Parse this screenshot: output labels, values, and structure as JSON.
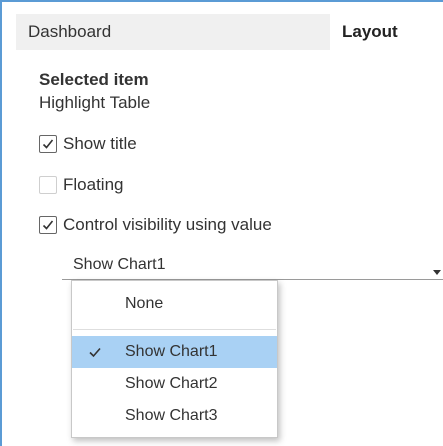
{
  "tabs": [
    {
      "label": "Dashboard"
    },
    {
      "label": "Layout"
    }
  ],
  "selected_item": {
    "heading": "Selected item",
    "value": "Highlight Table"
  },
  "options": [
    {
      "label": "Show title",
      "checked": true
    },
    {
      "label": "Floating",
      "checked": false
    },
    {
      "label": "Control visibility using value",
      "checked": true
    }
  ],
  "visibility_select": {
    "value": "Show Chart1",
    "arrow_icon": "caret-down-icon"
  },
  "dropdown": {
    "items": [
      {
        "label": "None",
        "selected": false
      },
      {
        "label": "Show Chart1",
        "selected": true
      },
      {
        "label": "Show Chart2",
        "selected": false
      },
      {
        "label": "Show Chart3",
        "selected": false
      }
    ],
    "check_icon": "checkmark-icon",
    "highlight_color": "#a9d1f4"
  },
  "colors": {
    "frame_border": "#5b9bd5",
    "inactive_tab": "#f0f0f0",
    "text": "#333333"
  }
}
